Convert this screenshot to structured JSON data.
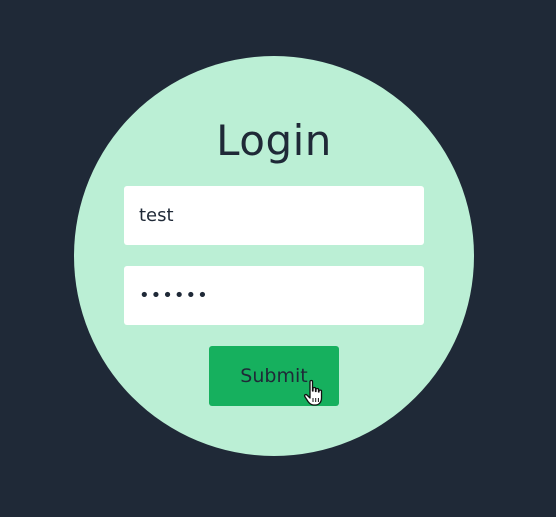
{
  "login": {
    "title": "Login",
    "username_value": "test",
    "password_value": "••••••",
    "submit_label": "Submit"
  },
  "colors": {
    "background": "#1f2937",
    "circle": "#bbefd5",
    "button": "#16b05e",
    "text": "#1f2937"
  },
  "icons": {
    "cursor": "hand-pointer-icon"
  }
}
